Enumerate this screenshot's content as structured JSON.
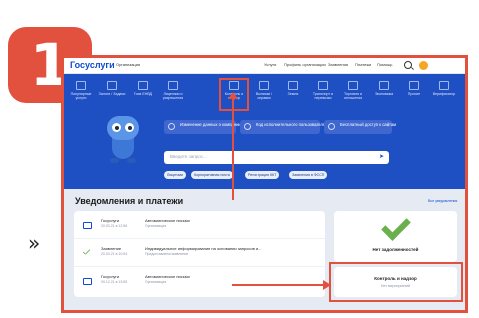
{
  "badge_number": "1",
  "side_glyph": "»",
  "header": {
    "logo": "Госуслуги",
    "org_menu": "Организация",
    "links": [
      "Услуги",
      "Профиль организации",
      "Заявления",
      "Платежи",
      "Помощь"
    ]
  },
  "hero": {
    "icons": [
      {
        "icon": "document-icon",
        "label": "Популярные услуги"
      },
      {
        "icon": "document-icon",
        "label": "Залоги / Задачи"
      },
      {
        "icon": "document-icon",
        "label": "Госв ЕНВД"
      },
      {
        "icon": "document-icon",
        "label": "Лицензии и разрешения"
      },
      {
        "icon": "document-icon",
        "label": "Контроль и надзор"
      },
      {
        "icon": "document-icon",
        "label": "Выписки / справки"
      },
      {
        "icon": "document-icon",
        "label": "Земля"
      },
      {
        "icon": "document-icon",
        "label": "Транспорт и перевозки"
      },
      {
        "icon": "document-icon",
        "label": "Торговля и отношения"
      },
      {
        "icon": "document-icon",
        "label": "Экономика"
      },
      {
        "icon": "document-icon",
        "label": "Прочие"
      },
      {
        "icon": "document-icon",
        "label": "Верификатор"
      }
    ],
    "pills": [
      {
        "label": "Изменение данных о компании"
      },
      {
        "label": "Код исполнительного пользователя"
      },
      {
        "label": "Бесплатный доступ к сайтам"
      }
    ],
    "search_placeholder": "Введите запрос...",
    "chips": [
      "Лицензии",
      "Корпоративная почта",
      "Регистрация ККТ",
      "Заявления в ФССП"
    ]
  },
  "notifications": {
    "title": "Уведомления и платежи",
    "all_link": "Все уведомления",
    "rows": [
      {
        "who": "Госуслуги",
        "when": "20.03.21 в 12:56",
        "subject": "Автоматическое письмо",
        "desc": "Организация",
        "icon": "envelope-icon"
      },
      {
        "who": "Заявление",
        "when": "20.03.21 в 10:54",
        "subject": "Индивидуальное информирование на основании запросов и...",
        "desc": "Предоставлено/заявление",
        "icon": "check-icon"
      },
      {
        "who": "Госуслуги",
        "when": "09.12.21 в 13:55",
        "subject": "Автоматическое письмо",
        "desc": "Организация",
        "icon": "envelope-icon"
      }
    ]
  },
  "debt": {
    "label": "Нет задолженностей"
  },
  "control": {
    "title": "Контроль и надзор",
    "subtitle": "Нет мероприятий"
  },
  "colors": {
    "accent": "#e2513e",
    "brand": "#0d4cd3",
    "hero": "#1e4fc3",
    "ok": "#6ab04c"
  }
}
